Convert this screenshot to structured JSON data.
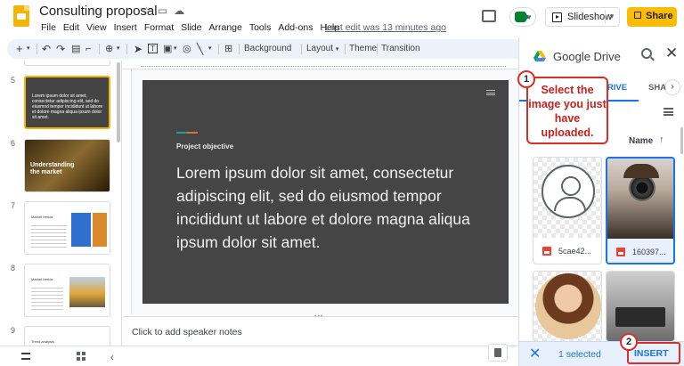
{
  "app": {
    "title": "Consulting proposal",
    "last_edit": "Last edit was 13 minutes ago",
    "menu": [
      "File",
      "Edit",
      "View",
      "Insert",
      "Format",
      "Slide",
      "Arrange",
      "Tools",
      "Add-ons",
      "Help"
    ]
  },
  "header": {
    "slideshow_label": "Slideshow",
    "share_label": "Share"
  },
  "toolbar": {
    "background_label": "Background",
    "layout_label": "Layout",
    "theme_label": "Theme",
    "transition_label": "Transition"
  },
  "filmstrip": {
    "slides": [
      {
        "num": "5",
        "title": "Lorem ipsum dolor sit amet, consectetur adipiscing elit, sed do eiusmod tempor incididunt ut labore et dolore magna aliqua ipsum dolor sit amet."
      },
      {
        "num": "6",
        "title": "Understanding the market"
      },
      {
        "num": "7",
        "title": "Market trends"
      },
      {
        "num": "8",
        "title": "Market trends"
      },
      {
        "num": "9",
        "title": "Trend analysis"
      }
    ]
  },
  "slide": {
    "label": "Project objective",
    "body": "Lorem ipsum dolor sit amet, consectetur adipiscing elit, sed do eiusmod tempor incididunt ut labore et dolore magna aliqua ipsum dolor sit amet.",
    "accent_colors": [
      "#1e9e9e",
      "#e0712c"
    ]
  },
  "notes": {
    "placeholder": "Click to add speaker notes"
  },
  "drive": {
    "title": "Google Drive",
    "tab_recent": "DRIVE",
    "tab_shared": "SHAR",
    "sort_label": "Name",
    "files": [
      {
        "name": "5cae42...",
        "selected": false
      },
      {
        "name": "160397...",
        "selected": true
      },
      {
        "name": "",
        "selected": false
      },
      {
        "name": "",
        "selected": false
      }
    ],
    "selected_count": "1 selected",
    "insert_label": "INSERT"
  },
  "annotations": {
    "step1_number": "1",
    "step1_text": "Select the image you just have uploaded.",
    "step2_number": "2"
  },
  "colors": {
    "accent_yellow": "#fbbc04",
    "drive_blue": "#1a73e8",
    "annotation_red": "#d93025"
  }
}
